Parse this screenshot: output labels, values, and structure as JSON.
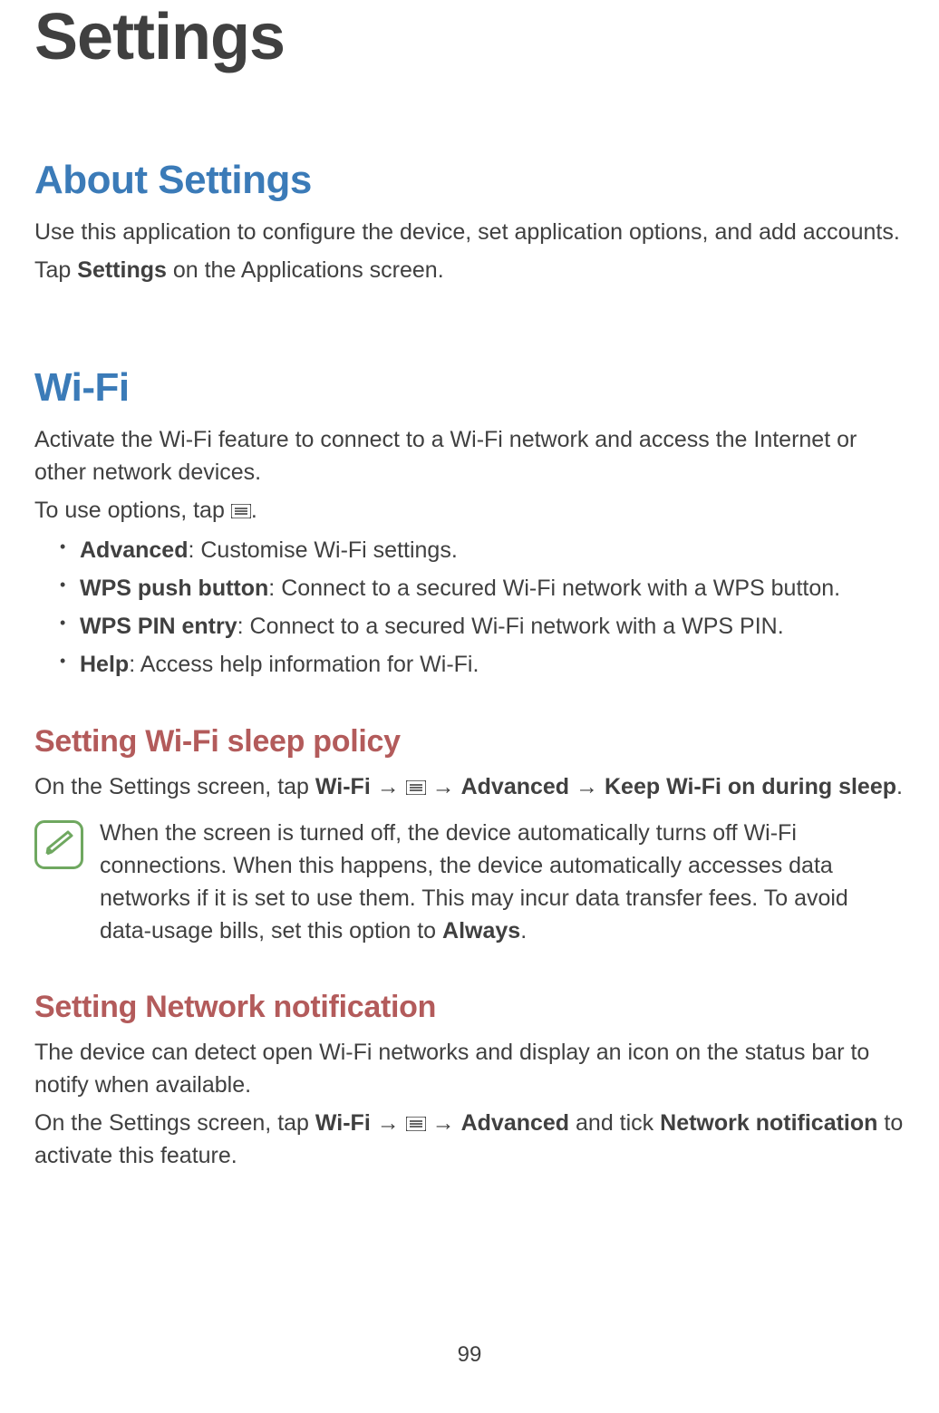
{
  "page_title": "Settings",
  "section_about": {
    "heading": "About Settings",
    "p1_pre": "Use this application to configure the device, set application options, and add accounts.",
    "p2_pre": "Tap ",
    "p2_bold": "Settings",
    "p2_post": " on the Applications screen."
  },
  "section_wifi": {
    "heading": "Wi-Fi",
    "intro": "Activate the Wi-Fi feature to connect to a Wi-Fi network and access the Internet or other network devices.",
    "options_pre": "To use options, tap ",
    "options_post": ".",
    "bullets": [
      {
        "bold": "Advanced",
        "rest": ": Customise Wi-Fi settings."
      },
      {
        "bold": "WPS push button",
        "rest": ": Connect to a secured Wi-Fi network with a WPS button."
      },
      {
        "bold": "WPS PIN entry",
        "rest": ": Connect to a secured Wi-Fi network with a WPS PIN."
      },
      {
        "bold": "Help",
        "rest": ": Access help information for Wi-Fi."
      }
    ]
  },
  "sub_sleep": {
    "heading": "Setting Wi-Fi sleep policy",
    "p_pre": "On the Settings screen, tap ",
    "p_wifi": "Wi-Fi",
    "arrow1": " → ",
    "arrow2": " → ",
    "p_adv": "Advanced",
    "arrow3": " → ",
    "p_keep": "Keep Wi-Fi on during sleep",
    "p_post": ".",
    "note_pre": "When the screen is turned off, the device automatically turns off Wi-Fi connections. When this happens, the device automatically accesses data networks if it is set to use them. This may incur data transfer fees. To avoid data-usage bills, set this option to ",
    "note_bold": "Always",
    "note_post": "."
  },
  "sub_network": {
    "heading": "Setting Network notification",
    "p1": "The device can detect open Wi-Fi networks and display an icon on the status bar to notify when available.",
    "p2_pre": "On the Settings screen, tap ",
    "p2_wifi": "Wi-Fi",
    "arrow1": " → ",
    "arrow2": " → ",
    "p2_adv": "Advanced",
    "p2_mid": " and tick ",
    "p2_nn": "Network notification",
    "p2_post": " to activate this feature."
  },
  "page_number": "99"
}
